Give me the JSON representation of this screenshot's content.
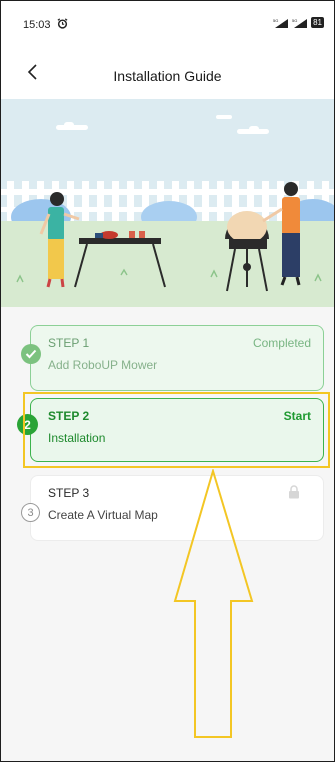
{
  "status_bar": {
    "time": "15:03",
    "battery": "81"
  },
  "header": {
    "title": "Installation Guide",
    "back_icon": "chevron-left-icon"
  },
  "steps": [
    {
      "title": "STEP 1",
      "subtitle": "Add RoboUP Mower",
      "status": "Completed",
      "badge": "check-icon",
      "state": "completed"
    },
    {
      "title": "STEP 2",
      "subtitle": "Installation",
      "status": "Start",
      "badge": "2",
      "state": "active"
    },
    {
      "title": "STEP 3",
      "subtitle": "Create A Virtual Map",
      "status": "",
      "badge": "3",
      "state": "locked"
    }
  ],
  "colors": {
    "accent_green": "#2aa436",
    "annotation_yellow": "#f3c624"
  }
}
